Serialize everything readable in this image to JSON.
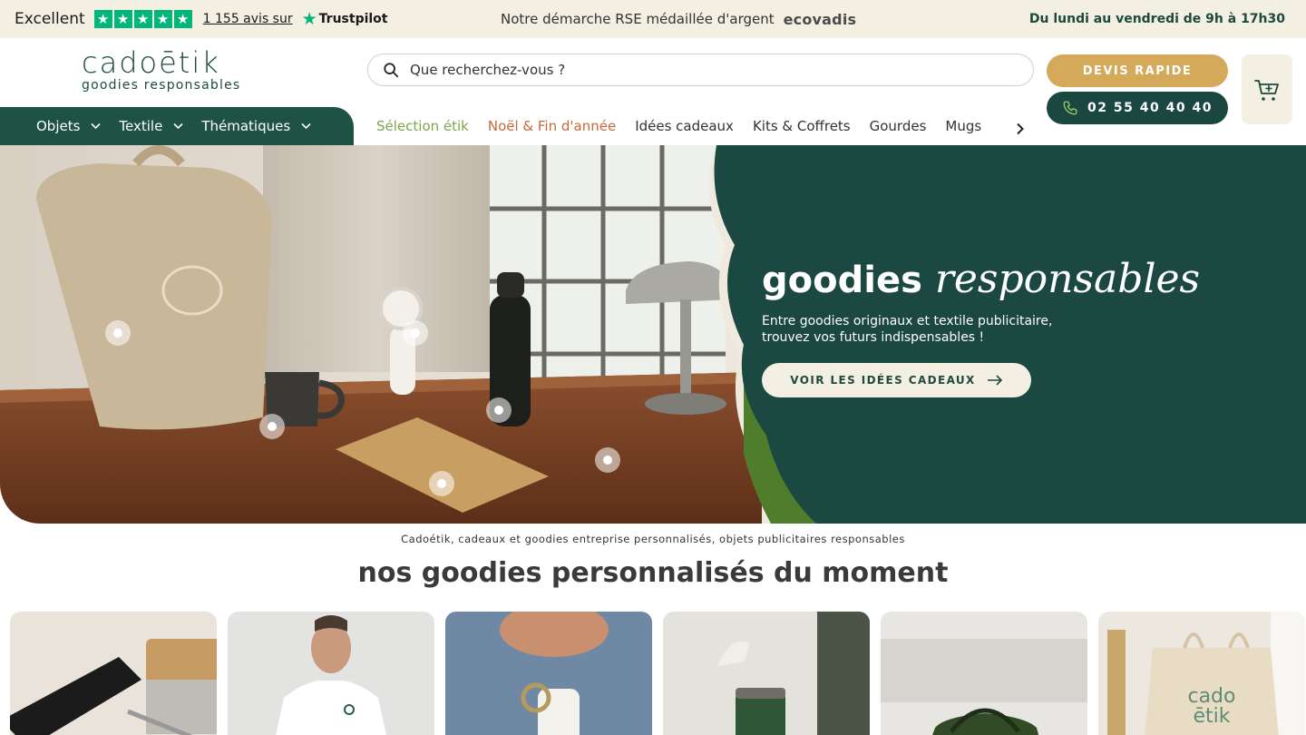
{
  "topbar": {
    "rating_label": "Excellent",
    "stars": [
      "★",
      "★",
      "★",
      "★",
      "★"
    ],
    "reviews_link": "1 155 avis sur",
    "trustpilot_label": "Trustpilot",
    "rse_text": "Notre démarche RSE médaillée d'argent",
    "ecovadis_label": "ecovadis",
    "hours": "Du lundi au vendredi de 9h à 17h30"
  },
  "header": {
    "logo_main": "cadoētik",
    "logo_sub": "goodies responsables",
    "search_placeholder": "Que recherchez-vous ?",
    "devis_button": "DEVIS RAPIDE",
    "phone_button": "02 55 40 40 40"
  },
  "mainnav": {
    "items": [
      {
        "label": "Objets"
      },
      {
        "label": "Textile"
      },
      {
        "label": "Thématiques"
      }
    ]
  },
  "subnav": {
    "items": [
      {
        "label": "Sélection étik",
        "color": "#7ea64f"
      },
      {
        "label": "Noël & Fin d'année",
        "color": "#c56a3c"
      },
      {
        "label": "Idées cadeaux"
      },
      {
        "label": "Kits & Coffrets"
      },
      {
        "label": "Gourdes"
      },
      {
        "label": "Mugs"
      }
    ]
  },
  "hero": {
    "title_bold": "goodies",
    "title_italic": "responsables",
    "subtitle_line1": "Entre goodies originaux et textile publicitaire,",
    "subtitle_line2": "trouvez vos futurs indispensables !",
    "cta": "VOIR LES IDÉES CADEAUX",
    "bg_color": "#1b4840"
  },
  "section": {
    "kicker": "Cadoétik, cadeaux et goodies entreprise personnalisés, objets publicitaires responsables",
    "title": "nos goodies personnalisés du moment"
  },
  "products": [
    {
      "icon": "cutlery-kit-photo"
    },
    {
      "icon": "tshirt-photo"
    },
    {
      "icon": "keychain-photo"
    },
    {
      "icon": "travel-mug-photo"
    },
    {
      "icon": "cooler-bag-photo"
    },
    {
      "icon": "tote-bag-photo"
    }
  ]
}
